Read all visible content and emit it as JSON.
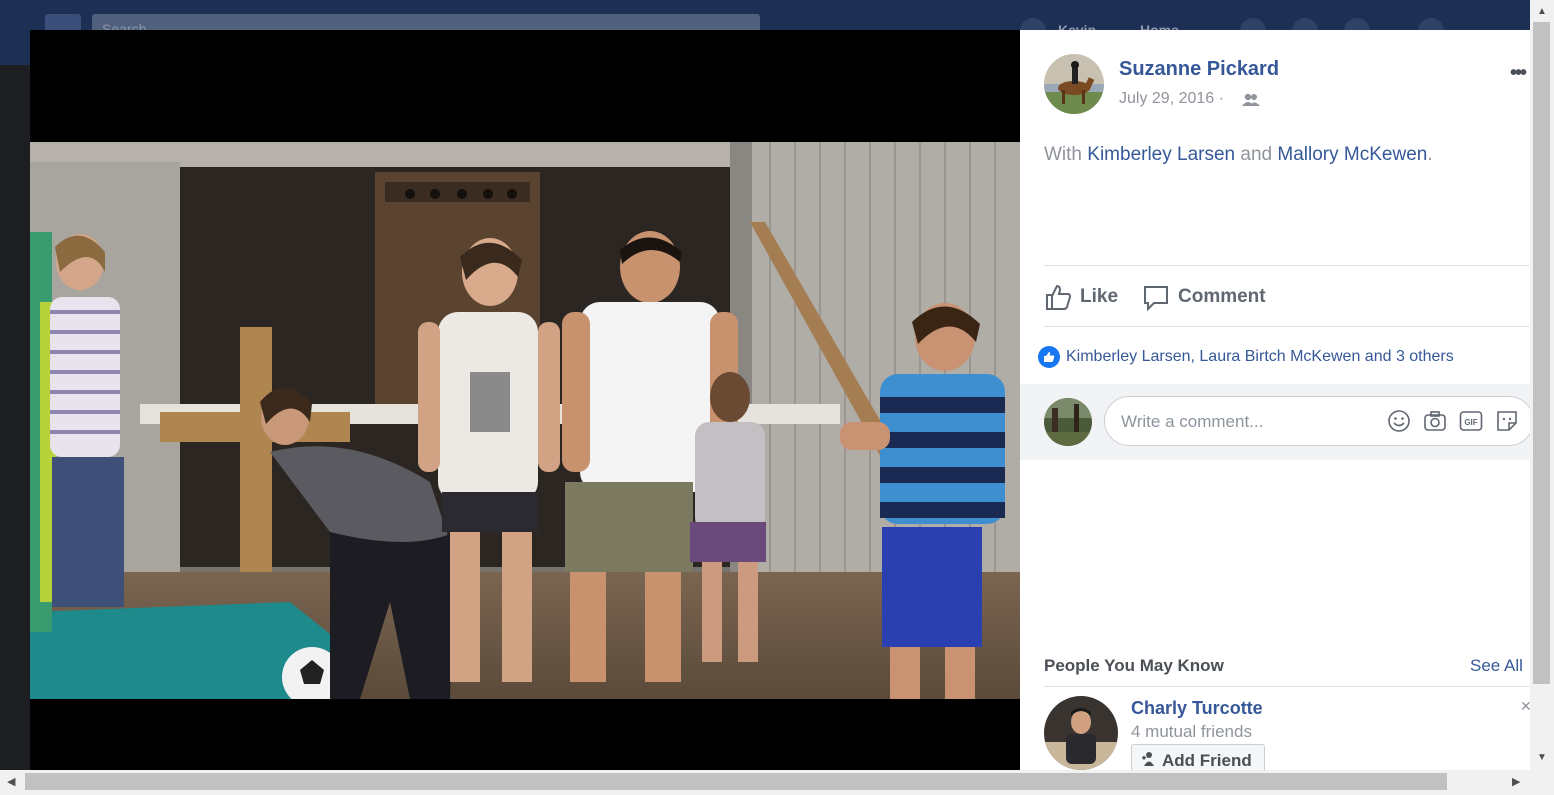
{
  "facebook_bar": {
    "search_placeholder": "Search",
    "user_name": "Kevin",
    "home_label": "Home"
  },
  "post": {
    "author": "Suzanne Pickard",
    "date": "July 29, 2016 ·",
    "with_prefix": "With",
    "tagged_1": "Kimberley Larsen",
    "and_word": "and",
    "tagged_2": "Mallory McKewen",
    "period": "."
  },
  "actions": {
    "like_label": "Like",
    "comment_label": "Comment"
  },
  "reactions": {
    "summary": "Kimberley Larsen, Laura Birtch McKewen and 3 others"
  },
  "comment": {
    "placeholder": "Write a comment...",
    "gif_label": "GIF"
  },
  "pymk": {
    "title": "People You May Know",
    "see_all": "See All",
    "person_name": "Charly Turcotte",
    "mutual": "4 mutual friends",
    "add_friend": "Add Friend"
  },
  "colors": {
    "link": "#365899",
    "facebook_blue": "#1877f2",
    "topbar": "#1d2f55"
  },
  "icons": [
    "friends-icon",
    "more-icon",
    "like-icon",
    "comment-icon",
    "emoji-icon",
    "camera-icon",
    "gif-icon",
    "sticker-icon",
    "add-friend-icon",
    "close-icon"
  ]
}
